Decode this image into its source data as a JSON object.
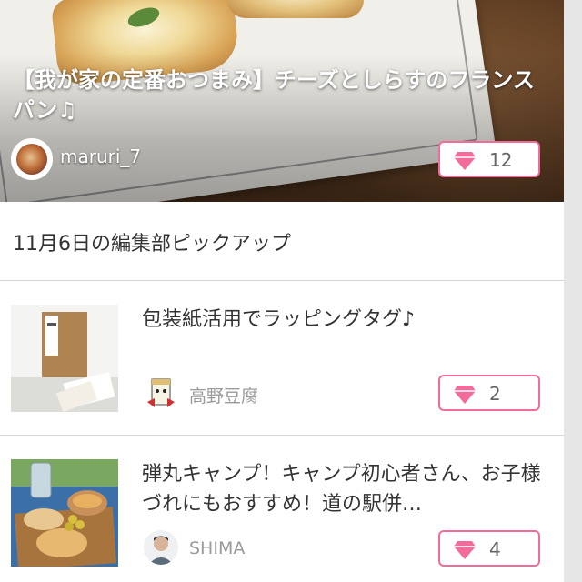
{
  "featured": {
    "title": "【我が家の定番おつまみ】チーズとしらすのフランスパン♫",
    "author": "maruri_7",
    "likes": "12"
  },
  "section": {
    "title": "11月6日の編集部ピックアップ"
  },
  "articles": [
    {
      "title": "包装紙活用でラッピングタグ♪",
      "author": "高野豆腐",
      "likes": "2"
    },
    {
      "title": "弾丸キャンプ！キャンプ初心者さん、お子様づれにもおすすめ！道の駅併…",
      "author": "SHIMA",
      "likes": "4"
    }
  ],
  "colors": {
    "accent": "#f26b9b",
    "text": "#333333",
    "muted": "#9a9a9a",
    "divider": "#d6d6d6"
  },
  "icons": {
    "like": "heart-gem-icon"
  }
}
